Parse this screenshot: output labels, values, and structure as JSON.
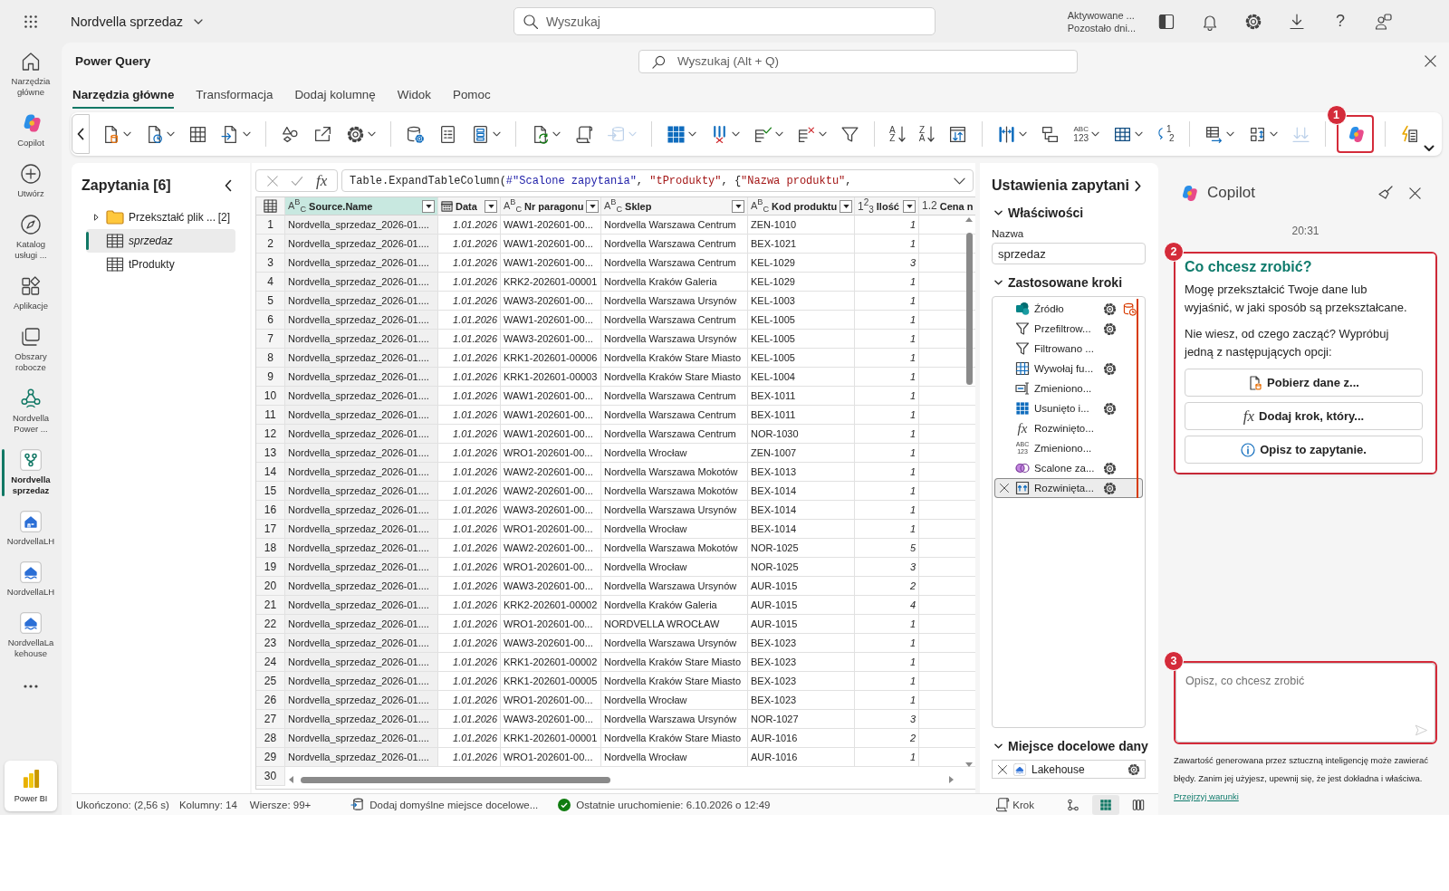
{
  "top_bar": {
    "workspace": "Nordvella sprzedaz",
    "search": {
      "placeholder": "Wyszukaj"
    },
    "trial": [
      "Aktywowane ...",
      "Pozostało dni..."
    ],
    "help": "?"
  },
  "left_rail": {
    "items": [
      {
        "kind": "home",
        "label": "Narzędzia główne",
        "selected": false
      },
      {
        "kind": "copilot",
        "label": "Copilot",
        "selected": false
      },
      {
        "kind": "create",
        "label": "Utwórz",
        "selected": false
      },
      {
        "kind": "catalog",
        "label": "Katalog usługi ...",
        "selected": false
      },
      {
        "kind": "apps",
        "label": "Aplikacje",
        "selected": false
      },
      {
        "kind": "workspaces",
        "label": "Obszary robocze",
        "selected": false
      },
      {
        "kind": "workspace",
        "label": "Nordvella Power ...",
        "selected": false
      },
      {
        "kind": "dataflow",
        "label": "Nordvella sprzedaz",
        "selected": true
      },
      {
        "kind": "warehouse",
        "label": "NordvellaLH",
        "selected": false
      },
      {
        "kind": "lakehouse",
        "label": "NordvellaLH",
        "selected": false
      },
      {
        "kind": "lakehouse",
        "label": "NordvellaLakehouse",
        "selected": false
      }
    ],
    "product": "Power BI"
  },
  "power_query": {
    "title": "Power Query",
    "search": {
      "placeholder": "Wyszukaj (Alt + Q)"
    },
    "tabs": [
      {
        "label": "Narzędzia główne",
        "selected": true
      },
      {
        "label": "Transformacja",
        "selected": false
      },
      {
        "label": "Dodaj kolumnę",
        "selected": false
      },
      {
        "label": "Widok",
        "selected": false
      },
      {
        "label": "Pomoc",
        "selected": false
      }
    ],
    "toolbar": {
      "groups": [
        [
          {
            "kind": "getdata",
            "dropdown": true,
            "disabled": false
          },
          {
            "kind": "recent",
            "dropdown": true,
            "disabled": false
          },
          {
            "kind": "enterdata",
            "dropdown": false,
            "disabled": false
          },
          {
            "kind": "import",
            "dropdown": true,
            "disabled": false
          }
        ],
        [
          {
            "kind": "connections",
            "dropdown": false,
            "disabled": false
          },
          {
            "kind": "export",
            "dropdown": false,
            "disabled": false
          },
          {
            "kind": "options",
            "dropdown": true,
            "disabled": false
          }
        ],
        [
          {
            "kind": "parameters",
            "dropdown": false,
            "disabled": false
          },
          {
            "kind": "properties",
            "dropdown": false,
            "disabled": false
          },
          {
            "kind": "editor",
            "dropdown": true,
            "disabled": false
          }
        ],
        [
          {
            "kind": "refresh",
            "dropdown": true,
            "disabled": false
          },
          {
            "kind": "script",
            "dropdown": false,
            "disabled": false
          },
          {
            "kind": "destination",
            "dropdown": true,
            "disabled": true
          }
        ],
        [
          {
            "kind": "choosecolumns",
            "dropdown": true,
            "disabled": false
          },
          {
            "kind": "removecolumns",
            "dropdown": true,
            "disabled": false
          },
          {
            "kind": "keeprows",
            "dropdown": true,
            "disabled": false
          },
          {
            "kind": "removerows",
            "dropdown": true,
            "disabled": false
          },
          {
            "kind": "filter",
            "dropdown": false,
            "disabled": false
          }
        ],
        [
          {
            "kind": "sortasc",
            "glyph": [
              "A",
              "Z"
            ],
            "dropdown": false,
            "disabled": false
          },
          {
            "kind": "sortdesc",
            "glyph": [
              "Z",
              "A"
            ],
            "dropdown": false,
            "disabled": false
          },
          {
            "kind": "transpose",
            "dropdown": false,
            "disabled": false
          }
        ],
        [
          {
            "kind": "split",
            "dropdown": true,
            "disabled": false
          },
          {
            "kind": "groupby",
            "dropdown": false,
            "disabled": false
          },
          {
            "kind": "datatype",
            "glyph": [
              "ABC",
              "123"
            ],
            "dropdown": true,
            "disabled": false
          },
          {
            "kind": "headers",
            "dropdown": true,
            "disabled": false
          },
          {
            "kind": "replace",
            "glyph": [
              "1",
              "2"
            ],
            "dropdown": false,
            "disabled": false
          }
        ],
        [
          {
            "kind": "merge",
            "dropdown": true,
            "disabled": false
          },
          {
            "kind": "append",
            "dropdown": true,
            "disabled": false
          },
          {
            "kind": "combine",
            "dropdown": false,
            "disabled": true
          }
        ],
        [
          {
            "kind": "copilot",
            "dropdown": false,
            "disabled": false,
            "annotation": "1"
          }
        ],
        [
          {
            "kind": "insights",
            "dropdown": false,
            "disabled": false
          }
        ]
      ]
    },
    "queries": {
      "title": "Zapytania [6]",
      "items": [
        {
          "kind": "folder",
          "label": "Przekształć plik ...",
          "count": "[2]",
          "expanded": false,
          "selected": false,
          "load_enabled": true
        },
        {
          "kind": "table",
          "label": "sprzedaz",
          "selected": true,
          "load_enabled": false
        },
        {
          "kind": "table",
          "label": "tProdukty",
          "selected": false,
          "load_enabled": true
        }
      ]
    },
    "formula_bar": {
      "function_button": "fx",
      "tokens": [
        {
          "kind": "plain",
          "text": "Table.ExpandTableColumn("
        },
        {
          "kind": "identifier",
          "text": "#\"Scalone zapytania\""
        },
        {
          "kind": "plain",
          "text": ", "
        },
        {
          "kind": "string",
          "text": "\"tProdukty\""
        },
        {
          "kind": "plain",
          "text": ", {"
        },
        {
          "kind": "string",
          "text": "\"Nazwa produktu\""
        },
        {
          "kind": "plain",
          "text": ","
        }
      ]
    },
    "grid": {
      "columns": [
        {
          "kind": "text",
          "type_icon": "A$^{B}$$_{C}$",
          "label": "Source.Name",
          "selected": true,
          "dropdown": true
        },
        {
          "kind": "date",
          "label": "Data",
          "selected": false,
          "dropdown": true
        },
        {
          "kind": "text",
          "type_icon": "A$^{B}$$_{C}$",
          "label": "Nr paragonu",
          "selected": false,
          "dropdown": true
        },
        {
          "kind": "text",
          "type_icon": "A$^{B}$$_{C}$",
          "label": "Sklep",
          "selected": false,
          "dropdown": true
        },
        {
          "kind": "text",
          "type_icon": "A$^{B}$$_{C}$",
          "label": "Kod produktu",
          "selected": false,
          "dropdown": true
        },
        {
          "kind": "integer",
          "type_icon": "1$^{2}$$_{3}$",
          "label": "Ilość",
          "selected": false,
          "dropdown": true
        },
        {
          "kind": "decimal",
          "type_icon": "1.2",
          "label": "Cena n",
          "selected": false,
          "dropdown": false
        }
      ],
      "rows": [
        {
          "number": "1",
          "cells": [
            "Nordvella_sprzedaz_2026-01....",
            "1.01.2026",
            "WAW1-202601-00...",
            "Nordvella Warszawa Centrum",
            "ZEN-1010",
            "1"
          ]
        },
        {
          "number": "2",
          "cells": [
            "Nordvella_sprzedaz_2026-01....",
            "1.01.2026",
            "WAW1-202601-00...",
            "Nordvella Warszawa Centrum",
            "BEX-1021",
            "1"
          ]
        },
        {
          "number": "3",
          "cells": [
            "Nordvella_sprzedaz_2026-01....",
            "1.01.2026",
            "WAW1-202601-00...",
            "Nordvella Warszawa Centrum",
            "KEL-1029",
            "3"
          ]
        },
        {
          "number": "4",
          "cells": [
            "Nordvella_sprzedaz_2026-01....",
            "1.01.2026",
            "KRK2-202601-00001",
            "Nordvella Kraków Galeria",
            "KEL-1029",
            "1"
          ]
        },
        {
          "number": "5",
          "cells": [
            "Nordvella_sprzedaz_2026-01....",
            "1.01.2026",
            "WAW3-202601-00...",
            "Nordvella Warszawa Ursynów",
            "KEL-1003",
            "1"
          ]
        },
        {
          "number": "6",
          "cells": [
            "Nordvella_sprzedaz_2026-01....",
            "1.01.2026",
            "WAW1-202601-00...",
            "Nordvella Warszawa Centrum",
            "KEL-1005",
            "1"
          ]
        },
        {
          "number": "7",
          "cells": [
            "Nordvella_sprzedaz_2026-01....",
            "1.01.2026",
            "WAW3-202601-00...",
            "Nordvella Warszawa Ursynów",
            "KEL-1005",
            "1"
          ]
        },
        {
          "number": "8",
          "cells": [
            "Nordvella_sprzedaz_2026-01....",
            "1.01.2026",
            "KRK1-202601-00006",
            "Nordvella Kraków Stare Miasto",
            "KEL-1005",
            "1"
          ]
        },
        {
          "number": "9",
          "cells": [
            "Nordvella_sprzedaz_2026-01....",
            "1.01.2026",
            "KRK1-202601-00003",
            "Nordvella Kraków Stare Miasto",
            "KEL-1004",
            "1"
          ]
        },
        {
          "number": "10",
          "cells": [
            "Nordvella_sprzedaz_2026-01....",
            "1.01.2026",
            "WAW1-202601-00...",
            "Nordvella Warszawa Centrum",
            "BEX-1011",
            "1"
          ]
        },
        {
          "number": "11",
          "cells": [
            "Nordvella_sprzedaz_2026-01....",
            "1.01.2026",
            "WAW1-202601-00...",
            "Nordvella Warszawa Centrum",
            "BEX-1011",
            "1"
          ]
        },
        {
          "number": "12",
          "cells": [
            "Nordvella_sprzedaz_2026-01....",
            "1.01.2026",
            "WAW1-202601-00...",
            "Nordvella Warszawa Centrum",
            "NOR-1030",
            "1"
          ]
        },
        {
          "number": "13",
          "cells": [
            "Nordvella_sprzedaz_2026-01....",
            "1.01.2026",
            "WRO1-202601-00...",
            "Nordvella Wrocław",
            "ZEN-1007",
            "1"
          ]
        },
        {
          "number": "14",
          "cells": [
            "Nordvella_sprzedaz_2026-01....",
            "1.01.2026",
            "WAW2-202601-00...",
            "Nordvella Warszawa Mokotów",
            "BEX-1013",
            "1"
          ]
        },
        {
          "number": "15",
          "cells": [
            "Nordvella_sprzedaz_2026-01....",
            "1.01.2026",
            "WAW2-202601-00...",
            "Nordvella Warszawa Mokotów",
            "BEX-1014",
            "1"
          ]
        },
        {
          "number": "16",
          "cells": [
            "Nordvella_sprzedaz_2026-01....",
            "1.01.2026",
            "WAW3-202601-00...",
            "Nordvella Warszawa Ursynów",
            "BEX-1014",
            "1"
          ]
        },
        {
          "number": "17",
          "cells": [
            "Nordvella_sprzedaz_2026-01....",
            "1.01.2026",
            "WRO1-202601-00...",
            "Nordvella Wrocław",
            "BEX-1014",
            "1"
          ]
        },
        {
          "number": "18",
          "cells": [
            "Nordvella_sprzedaz_2026-01....",
            "1.01.2026",
            "WAW2-202601-00...",
            "Nordvella Warszawa Mokotów",
            "NOR-1025",
            "5"
          ]
        },
        {
          "number": "19",
          "cells": [
            "Nordvella_sprzedaz_2026-01....",
            "1.01.2026",
            "WRO1-202601-00...",
            "Nordvella Wrocław",
            "NOR-1025",
            "3"
          ]
        },
        {
          "number": "20",
          "cells": [
            "Nordvella_sprzedaz_2026-01....",
            "1.01.2026",
            "WAW3-202601-00...",
            "Nordvella Warszawa Ursynów",
            "AUR-1015",
            "2"
          ]
        },
        {
          "number": "21",
          "cells": [
            "Nordvella_sprzedaz_2026-01....",
            "1.01.2026",
            "KRK2-202601-00002",
            "Nordvella Kraków Galeria",
            "AUR-1015",
            "4"
          ]
        },
        {
          "number": "22",
          "cells": [
            "Nordvella_sprzedaz_2026-01....",
            "1.01.2026",
            "WRO1-202601-00...",
            "NORDVELLA WROCŁAW",
            "AUR-1015",
            "1"
          ]
        },
        {
          "number": "23",
          "cells": [
            "Nordvella_sprzedaz_2026-01....",
            "1.01.2026",
            "WAW3-202601-00...",
            "Nordvella Warszawa Ursynów",
            "BEX-1023",
            "1"
          ]
        },
        {
          "number": "24",
          "cells": [
            "Nordvella_sprzedaz_2026-01....",
            "1.01.2026",
            "KRK1-202601-00002",
            "Nordvella Kraków Stare Miasto",
            "BEX-1023",
            "1"
          ]
        },
        {
          "number": "25",
          "cells": [
            "Nordvella_sprzedaz_2026-01....",
            "1.01.2026",
            "KRK1-202601-00005",
            "Nordvella Kraków Stare Miasto",
            "BEX-1023",
            "1"
          ]
        },
        {
          "number": "26",
          "cells": [
            "Nordvella_sprzedaz_2026-01....",
            "1.01.2026",
            "WRO1-202601-00...",
            "Nordvella Wrocław",
            "BEX-1023",
            "1"
          ]
        },
        {
          "number": "27",
          "cells": [
            "Nordvella_sprzedaz_2026-01....",
            "1.01.2026",
            "WAW3-202601-00...",
            "Nordvella Warszawa Ursynów",
            "NOR-1027",
            "3"
          ]
        },
        {
          "number": "28",
          "cells": [
            "Nordvella_sprzedaz_2026-01....",
            "1.01.2026",
            "KRK1-202601-00001",
            "Nordvella Kraków Stare Miasto",
            "AUR-1016",
            "2"
          ]
        },
        {
          "number": "29",
          "cells": [
            "Nordvella_sprzedaz_2026-01....",
            "1.01.2026",
            "WRO1-202601-00...",
            "Nordvella Wrocław",
            "AUR-1016",
            "1"
          ]
        },
        {
          "number": "30"
        }
      ]
    },
    "query_settings": {
      "title": "Ustawienia zapytani",
      "properties": {
        "heading": "Właściwości",
        "expanded": true,
        "name_label": "Nazwa",
        "name_value": "sprzedaz"
      },
      "steps": {
        "heading": "Zastosowane kroki",
        "expanded": true,
        "items": [
          {
            "kind": "sharepoint",
            "label": "Źródło",
            "settings": true,
            "source_badge": true,
            "selected": false
          },
          {
            "kind": "filter",
            "label": "Przefiltrow...",
            "settings": true,
            "source_badge": false,
            "selected": false
          },
          {
            "kind": "filter",
            "label": "Filtrowano ...",
            "settings": false,
            "source_badge": false,
            "selected": false
          },
          {
            "kind": "invoke",
            "label": "Wywołaj fu...",
            "settings": true,
            "source_badge": false,
            "selected": false
          },
          {
            "kind": "rename",
            "label": "Zmieniono...",
            "settings": false,
            "source_badge": false,
            "selected": false
          },
          {
            "kind": "removecolumns",
            "label": "Usunięto i...",
            "settings": true,
            "source_badge": false,
            "selected": false
          },
          {
            "kind": "formula",
            "glyph": [
              "fx"
            ],
            "label": "Rozwinięto...",
            "settings": false,
            "source_badge": false,
            "selected": false
          },
          {
            "kind": "changetype",
            "glyph": [
              "ABC",
              "123"
            ],
            "label": "Zmieniono...",
            "settings": false,
            "source_badge": false,
            "selected": false
          },
          {
            "kind": "merge",
            "label": "Scalone za...",
            "settings": true,
            "source_badge": false,
            "selected": false
          },
          {
            "kind": "expand",
            "label": "Rozwinięta...",
            "settings": true,
            "source_badge": false,
            "selected": true
          }
        ]
      },
      "destination": {
        "heading": "Miejsce docelowe dany",
        "expanded": true,
        "label": "Lakehouse"
      }
    },
    "status_bar": {
      "completed": "Ukończono: (2,56 s)",
      "columns": "Kolumny: 14",
      "rows": "Wiersze: 99+",
      "destination": "Dodaj domyślne miejsce docelowe...",
      "last_run": "Ostatnie uruchomienie: 6.10.2026 o 12:49",
      "step_button": "Krok",
      "views": [
        {
          "kind": "diagram",
          "selected": false
        },
        {
          "kind": "table",
          "selected": true
        },
        {
          "kind": "schema",
          "selected": false
        }
      ]
    }
  },
  "copilot": {
    "title": "Copilot",
    "time": "20:31",
    "card": {
      "annotation": "2",
      "heading": "Co chcesz zrobić?",
      "paragraphs": [
        "Mogę przekształcić Twoje dane lub wyjaśnić, w jaki sposób są przekształcane.",
        "Nie wiesz, od czego zacząć? Wypróbuj jedną z następujących opcji:"
      ],
      "actions": [
        {
          "kind": "getdata",
          "label": "Pobierz dane z..."
        },
        {
          "kind": "formula",
          "glyph": "fx",
          "label": "Dodaj krok, który..."
        },
        {
          "kind": "describe",
          "label": "Opisz to zapytanie."
        }
      ]
    },
    "input": {
      "annotation": "3",
      "placeholder": "Opisz, co chcesz zrobić"
    },
    "disclaimer": "Zawartość generowana przez sztuczną inteligencję może zawierać błędy. Zanim jej użyjesz, upewnij się, że jest dokładna i właściwa.",
    "terms_link": "Przejrzyj warunki"
  }
}
